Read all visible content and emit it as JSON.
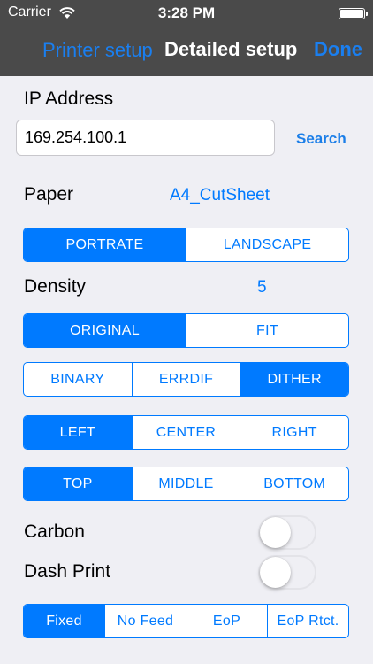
{
  "status_bar": {
    "carrier": "Carrier",
    "time": "3:28 PM",
    "wifi_icon": "wifi-icon",
    "battery_icon": "battery-icon",
    "battery_level": 1.0
  },
  "nav": {
    "back_label": "Printer setup",
    "title": "Detailed setup",
    "done_label": "Done"
  },
  "ip": {
    "label": "IP Address",
    "value": "169.254.100.1",
    "search_label": "Search"
  },
  "paper": {
    "label": "Paper",
    "value": "A4_CutSheet"
  },
  "orientation": {
    "options": [
      "PORTRATE",
      "LANDSCAPE"
    ],
    "selected": 0
  },
  "density": {
    "label": "Density",
    "value": "5"
  },
  "scaling": {
    "options": [
      "ORIGINAL",
      "FIT"
    ],
    "selected": 0
  },
  "halftone": {
    "options": [
      "BINARY",
      "ERRDIF",
      "DITHER"
    ],
    "selected": 2
  },
  "h_align": {
    "options": [
      "LEFT",
      "CENTER",
      "RIGHT"
    ],
    "selected": 0
  },
  "v_align": {
    "options": [
      "TOP",
      "MIDDLE",
      "BOTTOM"
    ],
    "selected": 0
  },
  "carbon": {
    "label": "Carbon",
    "on": false
  },
  "dash_print": {
    "label": "Dash Print",
    "on": false
  },
  "feed": {
    "options": [
      "Fixed",
      "No Feed",
      "EoP",
      "EoP Rtct."
    ],
    "selected": 0
  },
  "colors": {
    "accent": "#007aff",
    "bar": "#4a4a4a",
    "background": "#efeff4"
  }
}
